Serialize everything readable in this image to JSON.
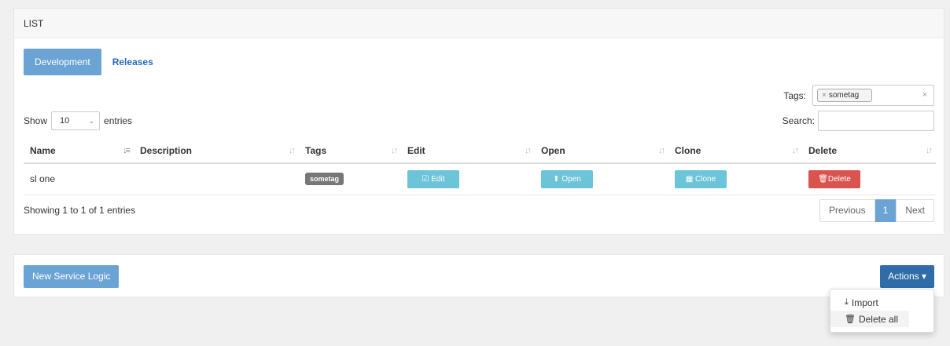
{
  "list_panel": {
    "title": "LIST",
    "tabs": [
      {
        "label": "Development",
        "active": true
      },
      {
        "label": "Releases",
        "active": false
      }
    ],
    "show_label": "Show",
    "entries_label": "entries",
    "page_size": "10",
    "tags_label": "Tags:",
    "selected_tag": "sometag",
    "search_label": "Search:",
    "search_value": "",
    "columns": [
      "Name",
      "Description",
      "Tags",
      "Edit",
      "Open",
      "Clone",
      "Delete"
    ],
    "rows": [
      {
        "name": "sl one",
        "description": "",
        "tag": "sometag",
        "edit_label": "Edit",
        "open_label": "Open",
        "clone_label": "Clone",
        "delete_label": "Delete"
      }
    ],
    "info": "Showing 1 to 1 of 1 entries",
    "pagination": {
      "previous": "Previous",
      "current": "1",
      "next": "Next"
    }
  },
  "actions_panel": {
    "new_button": "New Service Logic",
    "actions_button": "Actions",
    "menu": [
      {
        "label": "Import",
        "icon": "import-icon"
      },
      {
        "label": "Delete all",
        "icon": "trash-icon"
      }
    ]
  },
  "colors": {
    "primary": "#6aa3d4",
    "actions": "#2f6ca8",
    "info": "#6cc4d8",
    "danger": "#d9534f",
    "badge": "#777777"
  }
}
